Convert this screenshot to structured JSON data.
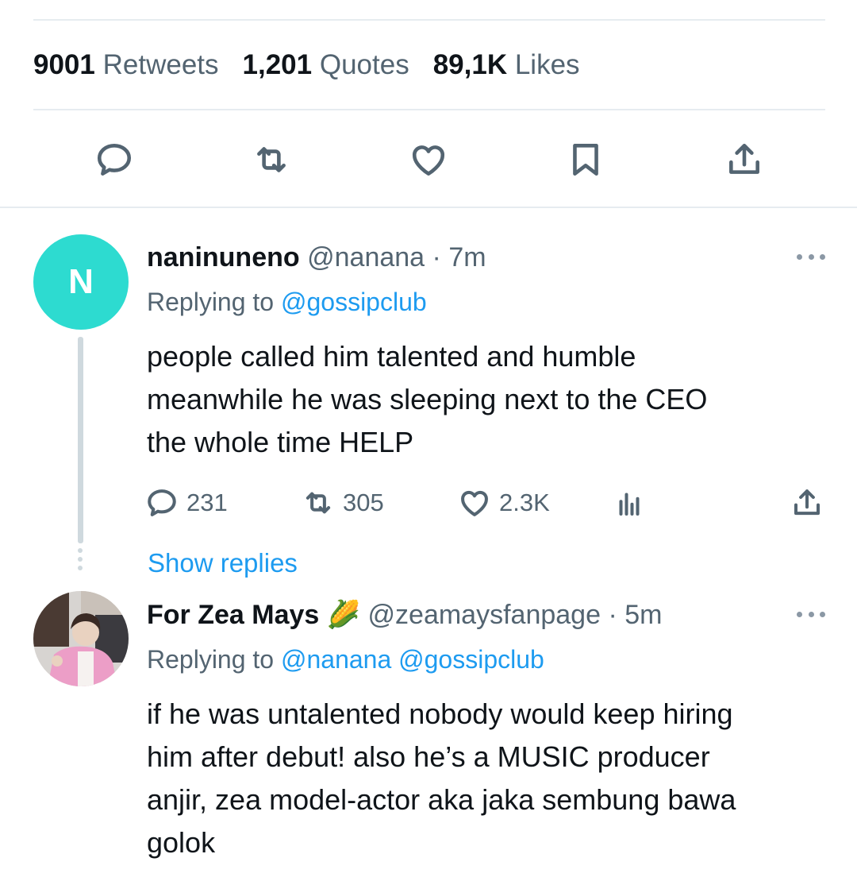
{
  "stats": {
    "retweets_count": "9001",
    "retweets_label": "Retweets",
    "quotes_count": "1,201",
    "quotes_label": "Quotes",
    "likes_count": "89,1K",
    "likes_label": "Likes"
  },
  "actions": [
    "reply-icon",
    "retweet-icon",
    "like-icon",
    "bookmark-icon",
    "share-icon"
  ],
  "colors": {
    "accent": "#1d9bf0",
    "avatar_bg": "#2ddbd0",
    "muted": "#536471",
    "divider": "#e6ecf0"
  },
  "reply1": {
    "avatar_letter": "N",
    "name": "naninuneno",
    "handle": "@nanana",
    "time": "· 7m",
    "replying_label": "Replying to",
    "replying_to": "@gossipclub",
    "text_lines": [
      "people called him talented and humble",
      "meanwhile he was sleeping next to the CEO",
      "the whole time HELP"
    ],
    "reply_count": "231",
    "retweet_count": "305",
    "like_count": "2.3K",
    "show_replies": "Show replies"
  },
  "reply2": {
    "name": "For Zea Mays 🌽",
    "handle": "@zeamaysfanpage",
    "time": "· 5m",
    "replying_label": "Replying to",
    "replying_to": "@nanana @gossipclub",
    "text_lines": [
      "if he was untalented nobody would keep hiring",
      "him after debut! also he’s a MUSIC producer",
      "anjir, zea model-actor aka jaka sembung bawa",
      "golok"
    ]
  }
}
